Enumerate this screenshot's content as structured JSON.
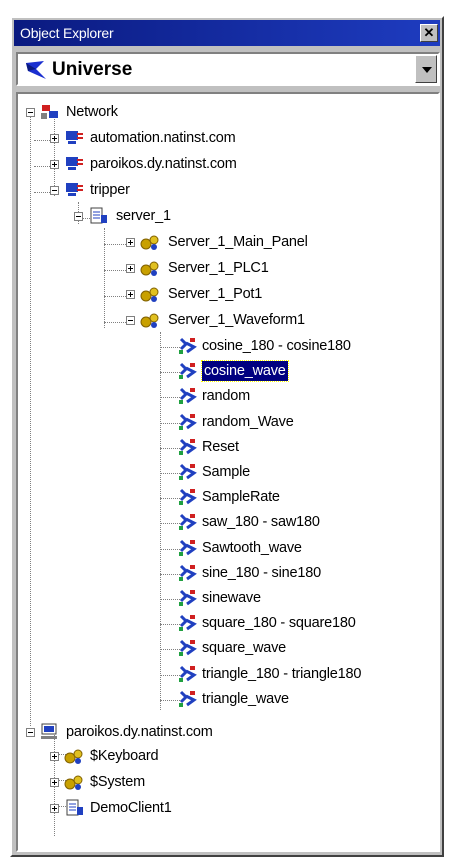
{
  "window": {
    "title": "Object Explorer",
    "close_glyph": "✕"
  },
  "combo": {
    "value": "Universe",
    "icon": "universe-logo-icon"
  },
  "tree": {
    "network": "Network",
    "automation": "automation.natinst.com",
    "paroikos_dy": "paroikos.dy.natinst.com",
    "tripper": "tripper",
    "server1": "server_1",
    "main_panel": "Server_1_Main_Panel",
    "plc1": "Server_1_PLC1",
    "pot1": "Server_1_Pot1",
    "waveform1": "Server_1_Waveform1",
    "items": [
      "cosine_180 - cosine180",
      "cosine_wave",
      "random",
      "random_Wave",
      "Reset",
      "Sample",
      "SampleRate",
      "saw_180 - saw180",
      "Sawtooth_wave",
      "sine_180 - sine180",
      "sinewave",
      "square_180 - square180",
      "square_wave",
      "triangle_180 - triangle180",
      "triangle_wave"
    ],
    "selected_item": "cosine_wave",
    "paroikos2": "paroikos.dy.natinst.com",
    "keyboard": "$Keyboard",
    "system": "$System",
    "democlient": "DemoClient1"
  },
  "colors": {
    "selection": "#000080",
    "titlebar": "#0a1a80",
    "face": "#c0c0c0"
  }
}
